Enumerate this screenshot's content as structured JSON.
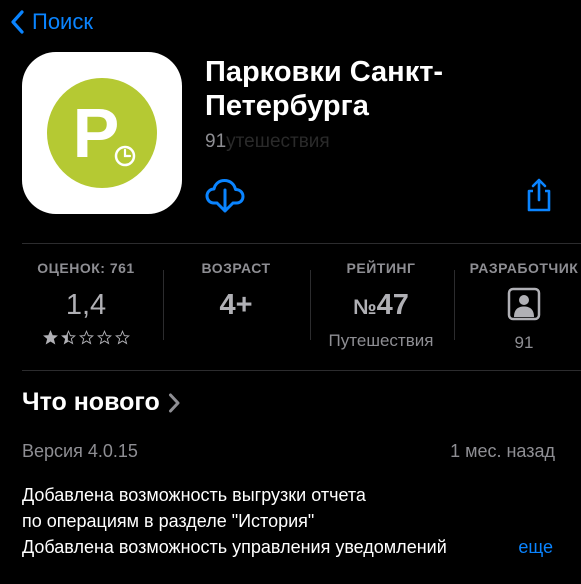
{
  "nav": {
    "back_label": "Поиск"
  },
  "app": {
    "title": "Парковки Санкт-Петербурга",
    "subtitle_visible": "91",
    "subtitle_faded": "утешествия",
    "icon_letter": "P",
    "icon_color": "#b5c933"
  },
  "stats": [
    {
      "label": "ОЦЕНОК: 761",
      "value": "1,4",
      "rating_stars": 1.4
    },
    {
      "label": "ВОЗРАСТ",
      "value": "4+"
    },
    {
      "label": "РЕЙТИНГ",
      "value_prefix": "№",
      "value": "47",
      "sub": "Путешествия"
    },
    {
      "label": "РАЗРАБОТЧИК",
      "icon": "developer-person-icon",
      "sub": "91"
    }
  ],
  "whats_new": {
    "heading": "Что нового",
    "version": "Версия 4.0.15",
    "ago": "1 мес. назад",
    "notes": [
      "Добавлена возможность выгрузки отчета",
      "по операциям в разделе \"История\"",
      "Добавлена возможность управления уведомлений"
    ],
    "more_label": "еще"
  },
  "colors": {
    "accent": "#0a84ff",
    "background": "#000000",
    "secondary_text": "#8e8e93"
  }
}
